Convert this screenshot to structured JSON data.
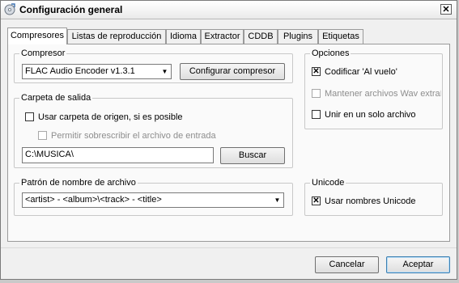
{
  "window": {
    "title": "Configuración general",
    "close_label": "✕"
  },
  "tabs": [
    {
      "label": "Compresores",
      "active": true
    },
    {
      "label": "Listas de reproducción",
      "active": false
    },
    {
      "label": "Idioma",
      "active": false
    },
    {
      "label": "Extractor",
      "active": false
    },
    {
      "label": "CDDB",
      "active": false
    },
    {
      "label": "Plugins",
      "active": false
    },
    {
      "label": "Etiquetas",
      "active": false
    }
  ],
  "compressor": {
    "legend": "Compresor",
    "selected": "FLAC Audio Encoder v1.3.1",
    "configure_label": "Configurar compresor"
  },
  "options": {
    "legend": "Opciones",
    "encode_on_fly": {
      "label": "Codificar 'Al vuelo'",
      "checked": true,
      "enabled": true
    },
    "keep_wav": {
      "label": "Mantener archivos Wav extraídos",
      "checked": false,
      "enabled": false
    },
    "single_file": {
      "label": "Unir en un solo archivo",
      "checked": false,
      "enabled": true
    }
  },
  "output": {
    "legend": "Carpeta de salida",
    "use_source": {
      "label": "Usar carpeta de origen, si es posible",
      "checked": false,
      "enabled": true
    },
    "allow_overwrite": {
      "label": "Permitir sobrescribir el archivo de entrada",
      "checked": false,
      "enabled": false
    },
    "path_value": "C:\\MUSICA\\",
    "browse_label": "Buscar"
  },
  "pattern": {
    "legend": "Patrón de nombre de archivo",
    "selected": "<artist> - <album>\\<track> - <title>"
  },
  "unicode": {
    "legend": "Unicode",
    "use_unicode": {
      "label": "Usar nombres Unicode",
      "checked": true,
      "enabled": true
    }
  },
  "footer": {
    "cancel_label": "Cancelar",
    "accept_label": "Aceptar"
  },
  "icons": {
    "app": "disc-icon",
    "close": "close-icon",
    "dropdown": "chevron-down-icon"
  }
}
